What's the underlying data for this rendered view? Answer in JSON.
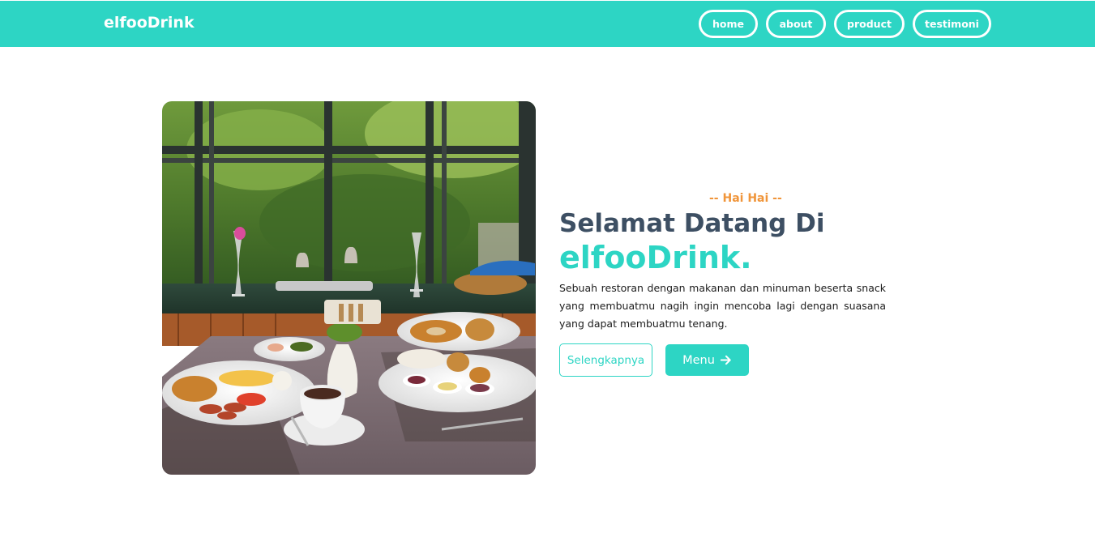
{
  "navbar": {
    "brand": "elfooDrink",
    "links": [
      {
        "label": "home"
      },
      {
        "label": "about"
      },
      {
        "label": "product"
      },
      {
        "label": "testimoni"
      }
    ],
    "color": "#2dd5c4"
  },
  "hero": {
    "image_icon": "restaurant-breakfast-photo",
    "tagline": "-- Hai Hai --",
    "title_line1": "Selamat Datang Di",
    "title_line2": "elfooDrink.",
    "description": "Sebuah restoran dengan makanan dan minuman beserta snack yang membuatmu nagih ingin mencoba lagi dengan suasana yang dapat membuatmu tenang.",
    "btn_more": "Selengkapnya",
    "btn_menu": "Menu",
    "btn_menu_icon": "arrow-right-icon",
    "accent_color": "#2dd5c4",
    "tagline_color": "#f0953a",
    "title_color": "#3d4f63"
  }
}
